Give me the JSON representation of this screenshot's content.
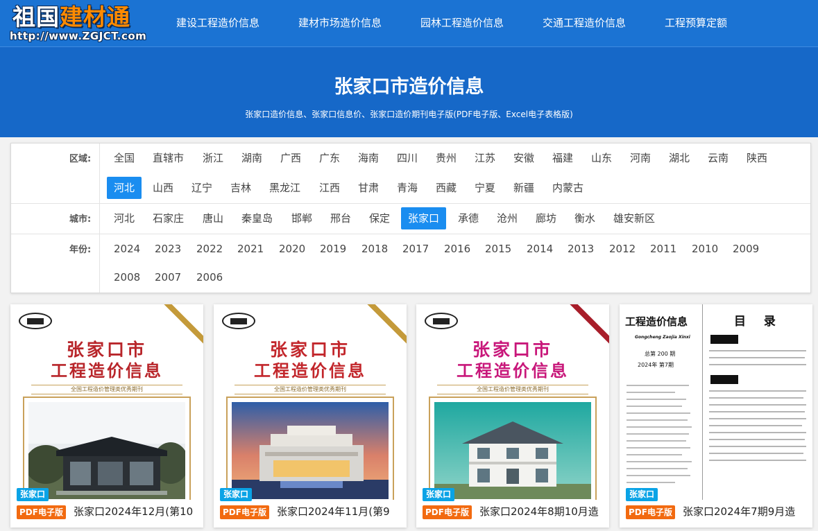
{
  "site": {
    "logo_part1": "祖国",
    "logo_part2": "建材通",
    "logo_url": "http://www.ZGJCT.com"
  },
  "nav": [
    "建设工程造价信息",
    "建材市场造价信息",
    "园林工程造价信息",
    "交通工程造价信息",
    "工程预算定额"
  ],
  "banner": {
    "title": "张家口市造价信息",
    "subtitle": "张家口造价信息、张家口信息价、张家口造价期刊电子版(PDF电子版、Excel电子表格版)"
  },
  "filters": {
    "region_label": "区域:",
    "regions": [
      "全国",
      "直辖市",
      "浙江",
      "湖南",
      "广西",
      "广东",
      "海南",
      "四川",
      "贵州",
      "江苏",
      "安徽",
      "福建",
      "山东",
      "河南",
      "湖北",
      "云南",
      "陕西",
      "河北",
      "山西",
      "辽宁",
      "吉林",
      "黑龙江",
      "江西",
      "甘肃",
      "青海",
      "西藏",
      "宁夏",
      "新疆",
      "内蒙古"
    ],
    "region_selected": "河北",
    "city_label": "城市:",
    "cities": [
      "河北",
      "石家庄",
      "唐山",
      "秦皇岛",
      "邯郸",
      "邢台",
      "保定",
      "张家口",
      "承德",
      "沧州",
      "廊坊",
      "衡水",
      "雄安新区"
    ],
    "city_selected": "张家口",
    "year_label": "年份:",
    "years": [
      "2024",
      "2023",
      "2022",
      "2021",
      "2020",
      "2019",
      "2018",
      "2017",
      "2016",
      "2015",
      "2014",
      "2013",
      "2012",
      "2011",
      "2010",
      "2009",
      "2008",
      "2007",
      "2006"
    ]
  },
  "cards": [
    {
      "cover_city": "张家口市",
      "cover_name": "工程造价信息",
      "cover_tag": "全国工程造价管理类优秀期刊",
      "badge_city": "张家口",
      "badge_format": "PDF电子版",
      "title": "张家口2024年12月(第10",
      "stripe_color": "#c49a3a",
      "title_color": "#b8252a"
    },
    {
      "cover_city": "张家口市",
      "cover_name": "工程造价信息",
      "cover_tag": "全国工程造价管理类优秀期刊",
      "badge_city": "张家口",
      "badge_format": "PDF电子版",
      "title": "张家口2024年11月(第9",
      "stripe_color": "#c49a3a",
      "title_color": "#c2262b"
    },
    {
      "cover_city": "张家口市",
      "cover_name": "工程造价信息",
      "cover_tag": "全国工程造价管理类优秀期刊",
      "badge_city": "张家口",
      "badge_format": "PDF电子版",
      "title": "张家口2024年8期10月造",
      "stripe_color": "#a81e2a",
      "title_color": "#c8177a"
    },
    {
      "doc_title": "工程造价信息",
      "doc_pinyin": "Gongcheng Zaojia Xinxi",
      "doc_total": "总第 200 期",
      "doc_issue": "2024年  第7期",
      "doc_toc": "目 录",
      "badge_city": "张家口",
      "badge_format": "PDF电子版",
      "title": "张家口2024年7期9月造"
    }
  ]
}
